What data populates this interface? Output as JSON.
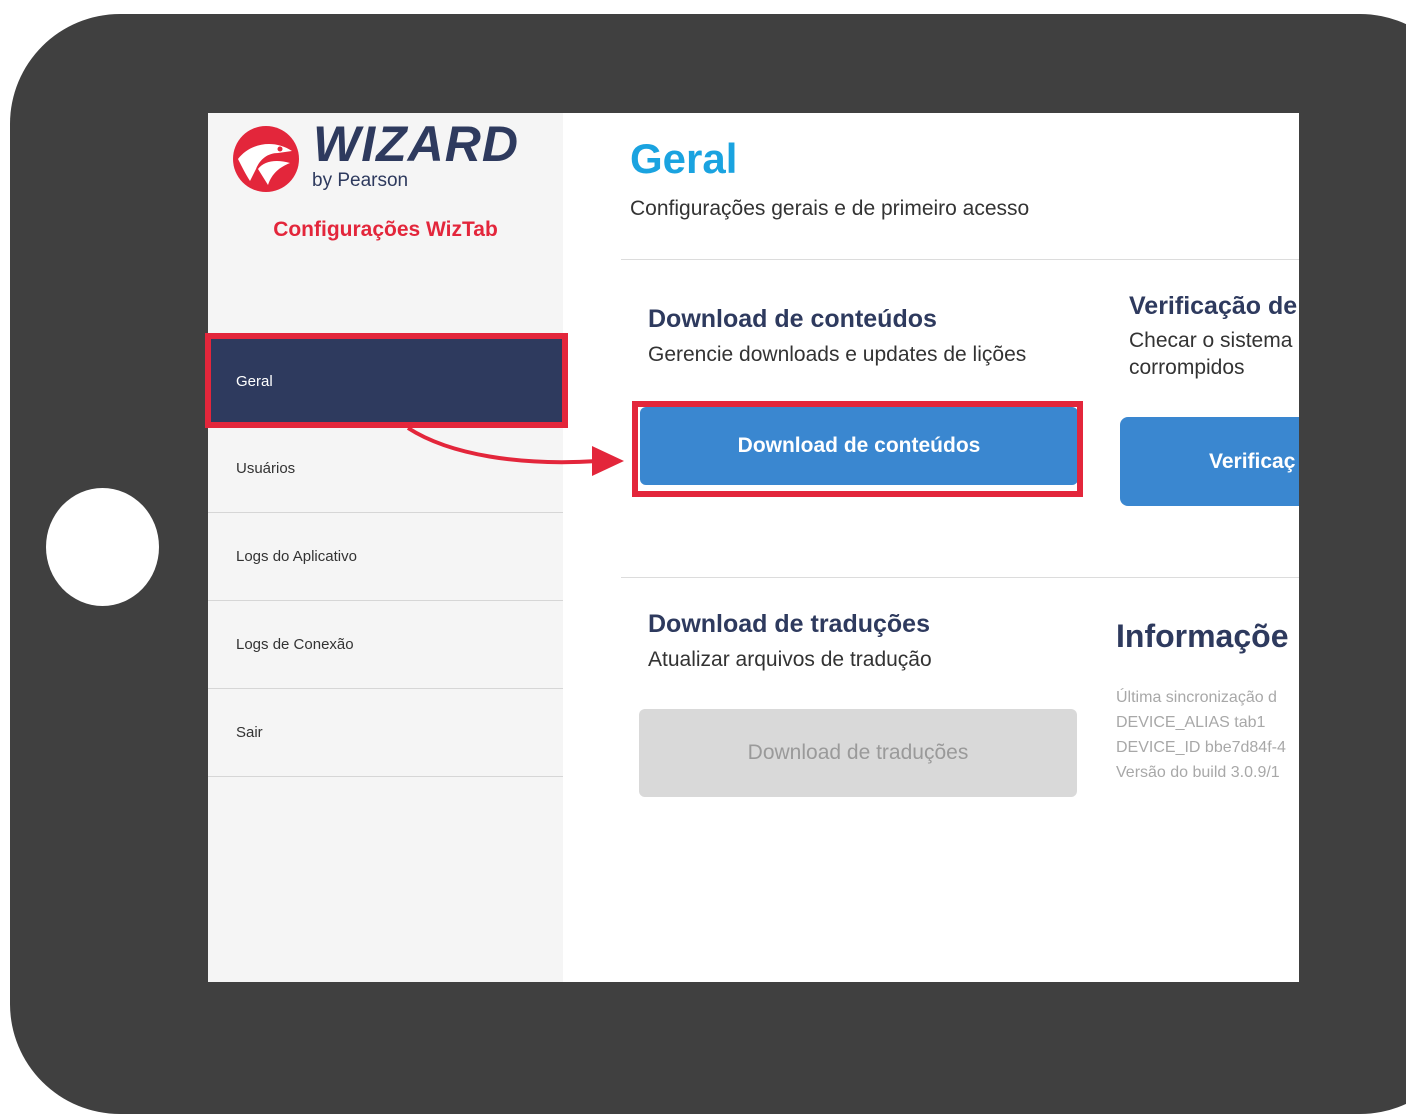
{
  "logo": {
    "wordmark": "WIZARD",
    "subtitle": "by Pearson"
  },
  "app_title": "Configurações WizTab",
  "nav": {
    "items": [
      {
        "label": "Geral",
        "active": true
      },
      {
        "label": "Usuários",
        "active": false
      },
      {
        "label": "Logs do Aplicativo",
        "active": false
      },
      {
        "label": "Logs de Conexão",
        "active": false
      },
      {
        "label": "Sair",
        "active": false
      }
    ]
  },
  "main": {
    "title": "Geral",
    "subtitle": "Configurações gerais e de primeiro acesso",
    "download_contents": {
      "title": "Download de conteúdos",
      "description": "Gerencie downloads e updates de lições",
      "button": "Download de conteúdos"
    },
    "verification": {
      "title": "Verificação de",
      "description_line1": "Checar o sistema",
      "description_line2": "corrompidos",
      "button": "Verificaç"
    },
    "download_translations": {
      "title": "Download de traduções",
      "description": "Atualizar arquivos de tradução",
      "button": "Download de traduções",
      "button_disabled": true
    },
    "info": {
      "title": "Informaçõe",
      "lines": [
        "Última sincronização d",
        "DEVICE_ALIAS tab1",
        "DEVICE_ID bbe7d84f-4",
        "Versão do build 3.0.9/1"
      ]
    }
  },
  "colors": {
    "navy": "#2e3a5e",
    "accent_red": "#e3263b",
    "title_blue": "#1aa3e0",
    "button_blue": "#3a87d0",
    "tablet_frame": "#404040"
  }
}
